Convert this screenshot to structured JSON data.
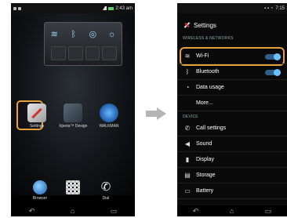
{
  "left": {
    "status_time": "2:43 am",
    "apps": [
      {
        "label": "Settings",
        "icon": "settings-icon"
      },
      {
        "label": "Xperia™ Design",
        "icon": "xdesign-icon"
      },
      {
        "label": "WALKMAN",
        "icon": "walkman-icon"
      }
    ],
    "dock": [
      {
        "label": "Browser",
        "icon": "browser-icon"
      },
      {
        "label": "",
        "icon": "apps-grid-icon"
      },
      {
        "label": "Dial",
        "icon": "phone-icon"
      }
    ],
    "nav_glyphs": [
      "↶",
      "⌂",
      "▭"
    ]
  },
  "right": {
    "status_time": "7:15",
    "title": "Settings",
    "section_wireless": "WIRELESS & NETWORKS",
    "section_device": "DEVICE",
    "rows": [
      {
        "label": "Wi-Fi",
        "icon": "wifi-icon",
        "glyph": "≋",
        "toggle": true
      },
      {
        "label": "Bluetooth",
        "icon": "bluetooth-icon",
        "glyph": "ᛒ",
        "toggle": true
      },
      {
        "label": "Data usage",
        "icon": "data-usage-icon",
        "glyph": "◔",
        "toggle": false
      },
      {
        "label": "More...",
        "icon": "",
        "glyph": "",
        "toggle": false
      },
      {
        "label": "Call settings",
        "icon": "call-icon",
        "glyph": "✆",
        "toggle": false
      },
      {
        "label": "Sound",
        "icon": "speaker-icon",
        "glyph": "◀",
        "toggle": false
      },
      {
        "label": "Display",
        "icon": "display-icon",
        "glyph": "▮",
        "toggle": false
      },
      {
        "label": "Storage",
        "icon": "storage-icon",
        "glyph": "▤",
        "toggle": false
      },
      {
        "label": "Battery",
        "icon": "battery-icon",
        "glyph": "▭",
        "toggle": false
      }
    ],
    "nav_glyphs": [
      "↶",
      "⌂",
      "▭"
    ]
  },
  "colors": {
    "highlight": "#e7a13a",
    "toggle_on": "#6bc1ff"
  }
}
